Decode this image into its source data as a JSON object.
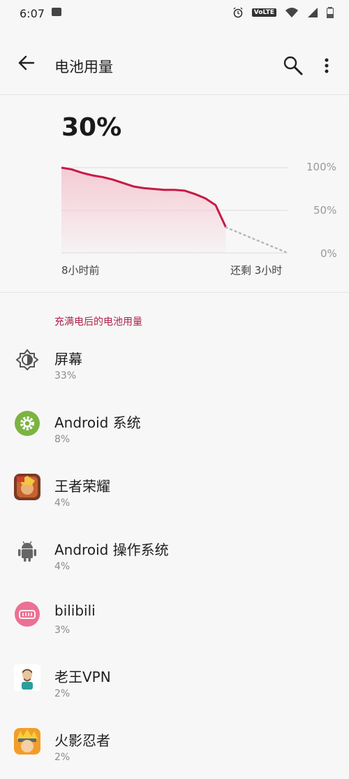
{
  "status": {
    "time": "6:07",
    "volte": "VoLTE"
  },
  "header": {
    "title": "电池用量"
  },
  "battery": {
    "percent": "30%",
    "level": 0.3
  },
  "chart_data": {
    "type": "area",
    "y_ticks": [
      "100%",
      "50%",
      "0%"
    ],
    "x_labels": [
      "8小时前",
      "还剩 3小时"
    ],
    "x": [
      0,
      0.5,
      1,
      1.5,
      2,
      2.5,
      3,
      3.5,
      4,
      4.5,
      5,
      5.5,
      6,
      6.5,
      7,
      7.5,
      8
    ],
    "values": [
      100,
      98,
      94,
      91,
      89,
      86,
      82,
      78,
      76,
      75,
      74,
      74,
      73,
      69,
      64,
      56,
      30
    ],
    "projection": {
      "x": [
        8,
        11
      ],
      "values": [
        30,
        0
      ]
    },
    "ylim": [
      0,
      100
    ],
    "grid": true,
    "colors": {
      "line": "#c81a44",
      "fill": "#f4c3ce",
      "projection": "#b8b8b8"
    }
  },
  "section_title": "充满电后的电池用量",
  "apps": [
    {
      "name": "屏幕",
      "usage": "33%",
      "icon": "brightness-icon"
    },
    {
      "name": "Android 系统",
      "usage": "8%",
      "icon": "android-system-gear-icon"
    },
    {
      "name": "王者荣耀",
      "usage": "4%",
      "icon": "honor-of-kings-app-icon"
    },
    {
      "name": "Android 操作系统",
      "usage": "4%",
      "icon": "android-robot-icon"
    },
    {
      "name": "bilibili",
      "usage": "3%",
      "icon": "bilibili-app-icon"
    },
    {
      "name": "老王VPN",
      "usage": "2%",
      "icon": "laowang-vpn-app-icon"
    },
    {
      "name": "火影忍者",
      "usage": "2%",
      "icon": "naruto-app-icon"
    }
  ]
}
